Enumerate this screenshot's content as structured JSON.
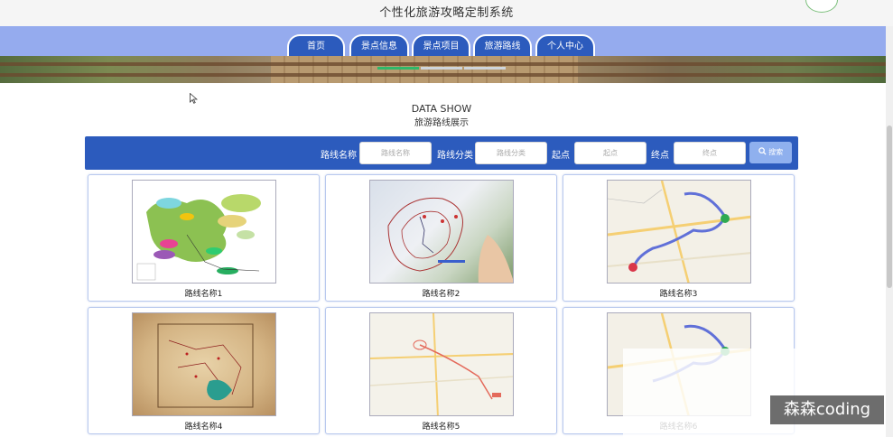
{
  "header": {
    "title": "个性化旅游攻略定制系统"
  },
  "nav": {
    "items": [
      {
        "label": "首页"
      },
      {
        "label": "景点信息"
      },
      {
        "label": "景点项目"
      },
      {
        "label": "旅游路线"
      },
      {
        "label": "个人中心"
      }
    ]
  },
  "section": {
    "title_en": "DATA SHOW",
    "title_zh": "旅游路线展示"
  },
  "search": {
    "fields": [
      {
        "label": "路线名称",
        "placeholder": "路线名称",
        "value": ""
      },
      {
        "label": "路线分类",
        "placeholder": "路线分类",
        "value": ""
      },
      {
        "label": "起点",
        "placeholder": "起点",
        "value": ""
      },
      {
        "label": "终点",
        "placeholder": "终点",
        "value": ""
      }
    ],
    "button_label": "搜索",
    "button_icon": "search-icon"
  },
  "cards": [
    {
      "title": "路线名称1",
      "image": "park-map"
    },
    {
      "title": "路线名称2",
      "image": "hand-drawn-route-map"
    },
    {
      "title": "路线名称3",
      "image": "road-map"
    },
    {
      "title": "路线名称4",
      "image": "antique-map"
    },
    {
      "title": "路线名称5",
      "image": "city-map"
    },
    {
      "title": "路线名称6",
      "image": "road-map"
    }
  ],
  "watermark": {
    "text": "森森coding"
  },
  "colors": {
    "primary": "#2c5bbd",
    "nav_background": "#95abee",
    "search_button": "#8fb0ee",
    "card_border": "#b9c9ee",
    "slider_active": "#2fb86a"
  }
}
